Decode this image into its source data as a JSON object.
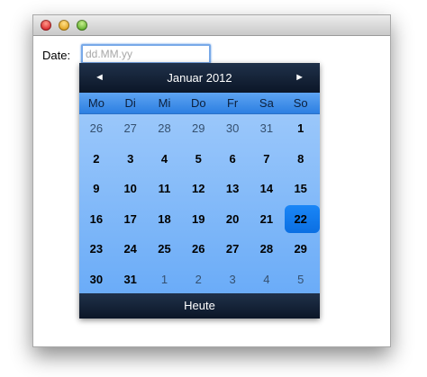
{
  "form": {
    "date_label": "Date:",
    "date_placeholder": "dd.MM.yy",
    "date_value": ""
  },
  "calendar": {
    "prev_symbol": "◄",
    "next_symbol": "►",
    "month_title": "Januar 2012",
    "weekdays": [
      "Mo",
      "Di",
      "Mi",
      "Do",
      "Fr",
      "Sa",
      "So"
    ],
    "weeks": [
      [
        "26",
        "27",
        "28",
        "29",
        "30",
        "31",
        "1"
      ],
      [
        "2",
        "3",
        "4",
        "5",
        "6",
        "7",
        "8"
      ],
      [
        "9",
        "10",
        "11",
        "12",
        "13",
        "14",
        "15"
      ],
      [
        "16",
        "17",
        "18",
        "19",
        "20",
        "21",
        "22"
      ],
      [
        "23",
        "24",
        "25",
        "26",
        "27",
        "28",
        "29"
      ],
      [
        "30",
        "31",
        "1",
        "2",
        "3",
        "4",
        "5"
      ]
    ],
    "today_button": "Heute",
    "selected_color": "#1a86f7"
  }
}
